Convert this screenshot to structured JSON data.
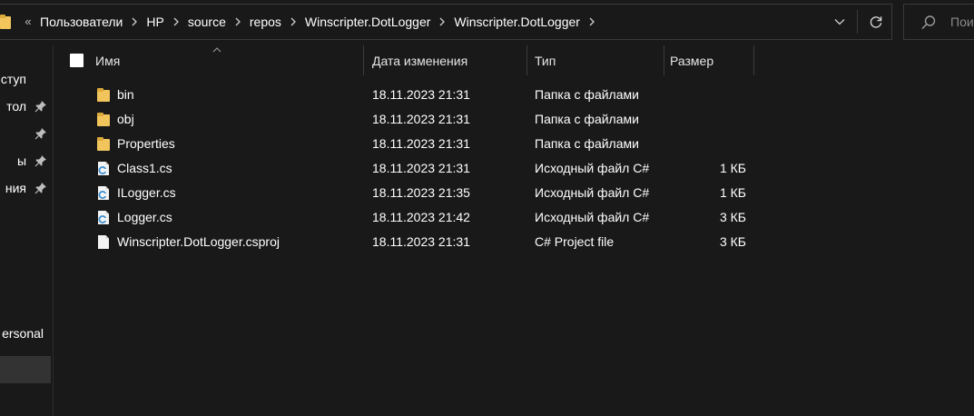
{
  "window": {
    "colors": {
      "background": "#191919",
      "folder": "#f2c55c",
      "folder_dark": "#dcaa3a",
      "cs_accent": "#3f8fd2",
      "selected_bg": "#333333"
    }
  },
  "address_bar": {
    "overflow_label": "«",
    "breadcrumbs": [
      "Пользователи",
      "HP",
      "source",
      "repos",
      "Winscripter.DotLogger",
      "Winscripter.DotLogger"
    ],
    "dropdown_icon": "chevron-down-icon",
    "refresh_icon": "refresh-icon"
  },
  "search": {
    "placeholder": "Пои"
  },
  "nav_pane": {
    "items": [
      {
        "label": "ступ",
        "pinned": false
      },
      {
        "label": "тол",
        "pinned": true
      },
      {
        "label": "",
        "pinned": true
      },
      {
        "label": "ы",
        "pinned": true
      },
      {
        "label": "ния",
        "pinned": true
      }
    ],
    "personal_label": "ersonal"
  },
  "columns": {
    "name": "Имя",
    "date": "Дата изменения",
    "type": "Тип",
    "size": "Размер"
  },
  "files": [
    {
      "name": "bin",
      "date": "18.11.2023 21:31",
      "type": "Папка с файлами",
      "size": "",
      "icon": "folder-icon"
    },
    {
      "name": "obj",
      "date": "18.11.2023 21:31",
      "type": "Папка с файлами",
      "size": "",
      "icon": "folder-icon"
    },
    {
      "name": "Properties",
      "date": "18.11.2023 21:31",
      "type": "Папка с файлами",
      "size": "",
      "icon": "folder-icon"
    },
    {
      "name": "Class1.cs",
      "date": "18.11.2023 21:31",
      "type": "Исходный файл C#",
      "size": "1 КБ",
      "icon": "csharp-file-icon"
    },
    {
      "name": "ILogger.cs",
      "date": "18.11.2023 21:35",
      "type": "Исходный файл C#",
      "size": "1 КБ",
      "icon": "csharp-file-icon"
    },
    {
      "name": "Logger.cs",
      "date": "18.11.2023 21:42",
      "type": "Исходный файл C#",
      "size": "3 КБ",
      "icon": "csharp-file-icon"
    },
    {
      "name": "Winscripter.DotLogger.csproj",
      "date": "18.11.2023 21:31",
      "type": "C# Project file",
      "size": "3 КБ",
      "icon": "file-icon"
    }
  ]
}
